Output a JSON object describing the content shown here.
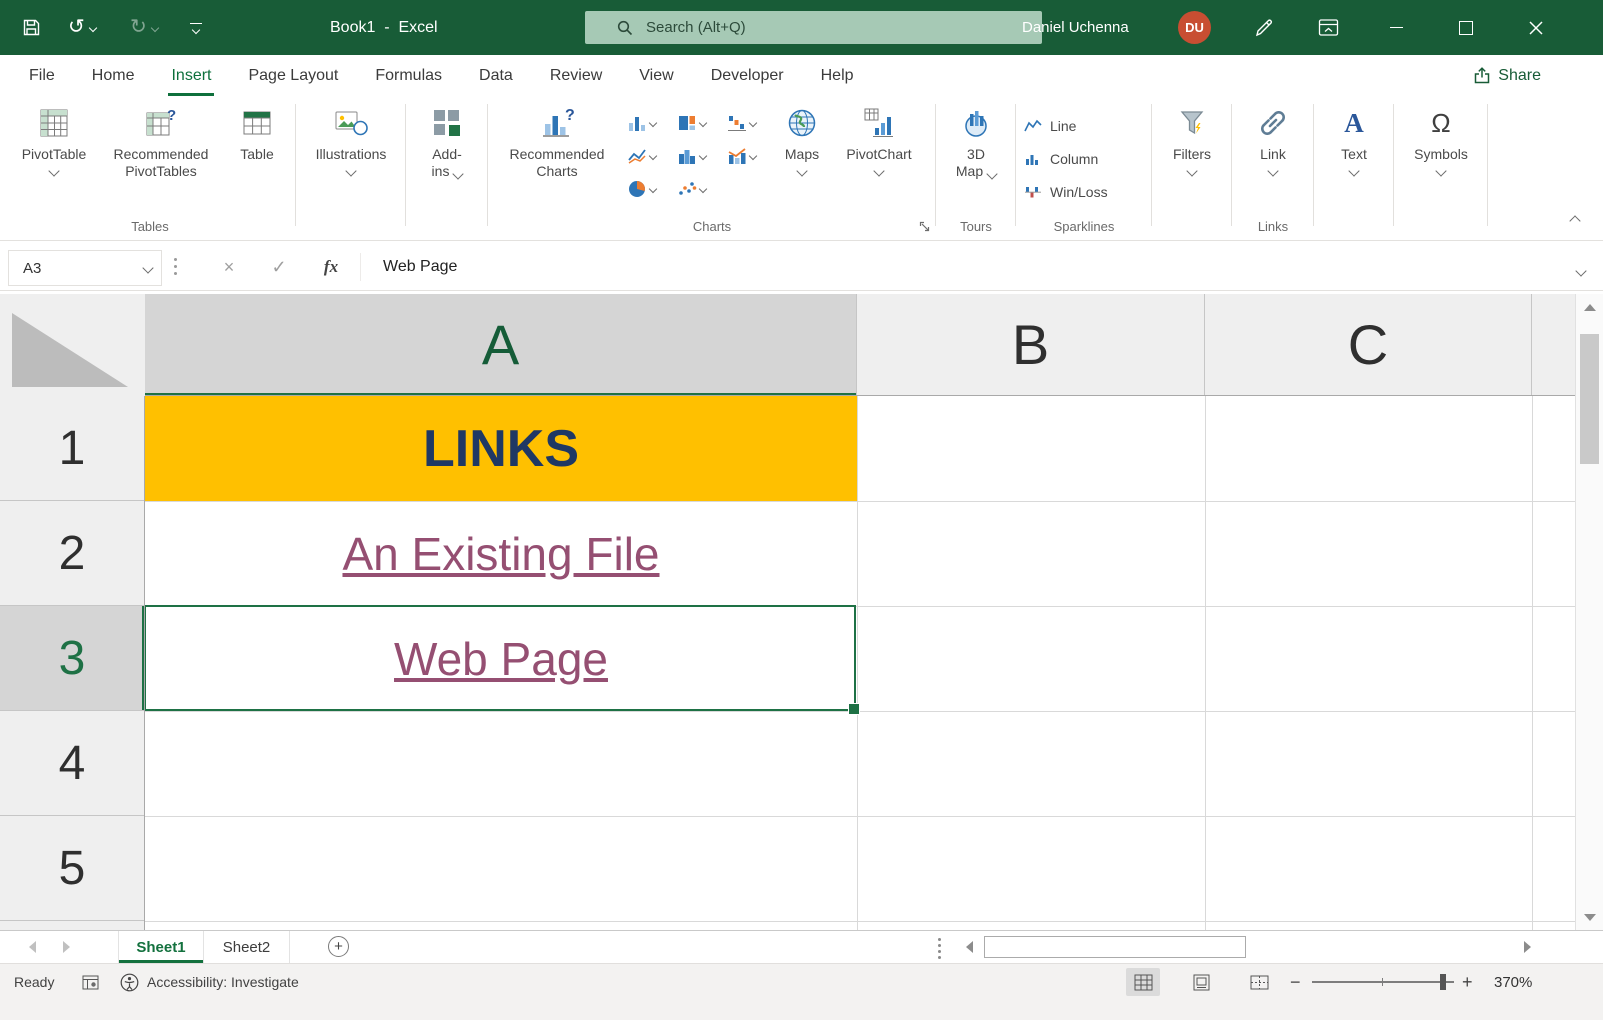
{
  "glyphs": {
    "undo": "↺",
    "redo": "↻",
    "cancel": "×",
    "enter": "✓",
    "omega": "Ω",
    "add_sheet": "+",
    "zoom_out": "−",
    "zoom_in": "+"
  },
  "title_bar": {
    "workbook_title": "Book1  -  Excel",
    "search_placeholder": "Search (Alt+Q)",
    "user_name": "Daniel Uchenna",
    "user_initials": "DU"
  },
  "tabs": {
    "items": [
      {
        "label": "File"
      },
      {
        "label": "Home"
      },
      {
        "label": "Insert",
        "active": true
      },
      {
        "label": "Page Layout"
      },
      {
        "label": "Formulas"
      },
      {
        "label": "Data"
      },
      {
        "label": "Review"
      },
      {
        "label": "View"
      },
      {
        "label": "Developer"
      },
      {
        "label": "Help"
      }
    ],
    "share_label": "Share"
  },
  "ribbon": {
    "pivottable": "PivotTable",
    "rec_pivot_1": "Recommended",
    "rec_pivot_2": "PivotTables",
    "table": "Table",
    "tables_group": "Tables",
    "illustrations": "Illustrations",
    "addins_1": "Add-",
    "addins_2": "ins",
    "rec_charts_1": "Recommended",
    "rec_charts_2": "Charts",
    "maps": "Maps",
    "pivotchart": "PivotChart",
    "charts_group": "Charts",
    "map3d_1": "3D",
    "map3d_2": "Map",
    "tours_group": "Tours",
    "spark_line": "Line",
    "spark_column": "Column",
    "spark_winloss": "Win/Loss",
    "sparklines_group": "Sparklines",
    "filters": "Filters",
    "link": "Link",
    "links_group": "Links",
    "text": "Text",
    "symbols": "Symbols"
  },
  "formula_bar": {
    "name_box": "A3",
    "fx": "fx",
    "value": "Web Page"
  },
  "grid": {
    "col_headers": [
      "A",
      "B",
      "C"
    ],
    "row_headers": [
      "1",
      "2",
      "3",
      "4",
      "5"
    ],
    "cells": {
      "A1": "LINKS",
      "A2": "An Existing File",
      "A3": "Web Page"
    }
  },
  "sheets": {
    "tabs": [
      {
        "label": "Sheet1",
        "active": true
      },
      {
        "label": "Sheet2"
      }
    ]
  },
  "status_bar": {
    "ready": "Ready",
    "accessibility": "Accessibility: Investigate",
    "zoom": "370%"
  },
  "colors": {
    "title_bar_green": "#185C37",
    "accent_green": "#1E7145",
    "a1_fill": "#FFC000",
    "a1_text": "#1F3864",
    "hyperlink_followed": "#954F72",
    "avatar_bg": "#C84E32"
  }
}
